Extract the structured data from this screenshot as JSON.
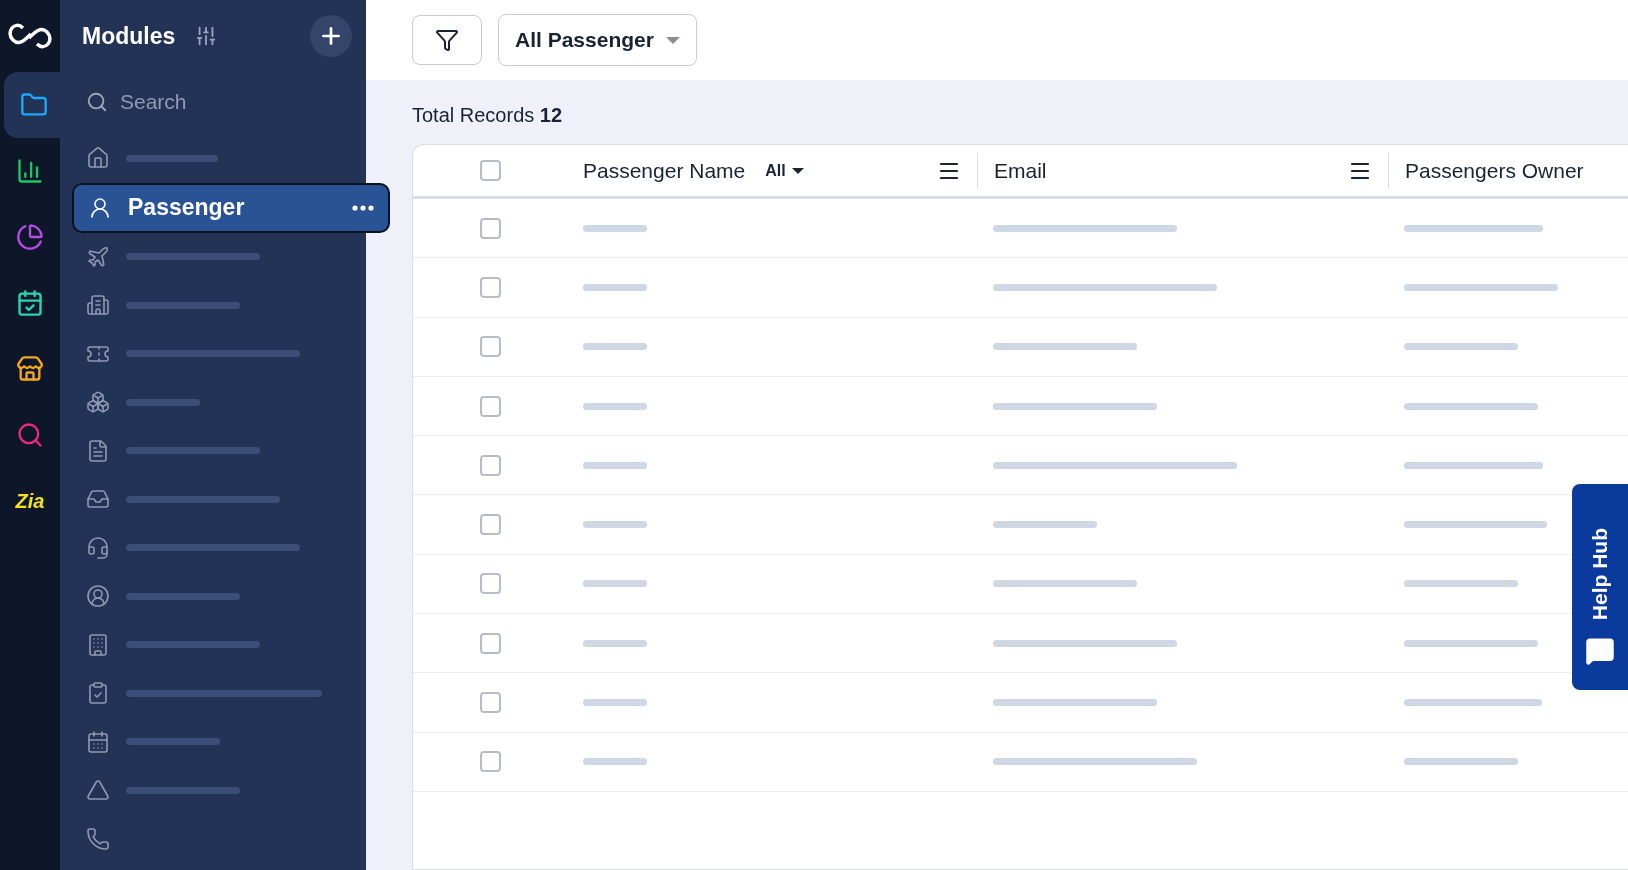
{
  "rail": {
    "items": [
      {
        "kind": "folder",
        "selected": true,
        "color": "#1ea7fd"
      },
      {
        "kind": "chart",
        "selected": false,
        "color": "#22c55e"
      },
      {
        "kind": "pie",
        "selected": false,
        "color": "#b44ce6"
      },
      {
        "kind": "calendar",
        "selected": false,
        "color": "#2ad4b4"
      },
      {
        "kind": "store",
        "selected": false,
        "color": "#f5a623"
      },
      {
        "kind": "search",
        "selected": false,
        "color": "#ec2a7a"
      },
      {
        "kind": "text",
        "label": "Zia",
        "selected": false,
        "color": "#f2e21c"
      }
    ]
  },
  "modules": {
    "title": "Modules",
    "search": {
      "placeholder": "Search"
    },
    "items": [
      {
        "selected": false
      },
      {
        "label": "Passenger",
        "selected": true
      },
      {
        "selected": false
      },
      {
        "selected": false
      },
      {
        "selected": false
      },
      {
        "selected": false
      },
      {
        "selected": false
      },
      {
        "selected": false
      },
      {
        "selected": false
      },
      {
        "selected": false
      },
      {
        "selected": false
      },
      {
        "selected": false
      },
      {
        "selected": false
      },
      {
        "selected": false
      },
      {
        "selected": false
      }
    ]
  },
  "toolbar": {
    "view": "All Passenger"
  },
  "total": {
    "label": "Total Records",
    "count": "12"
  },
  "table": {
    "select_all": {
      "checked": false
    },
    "columns": [
      {
        "label": "Passenger Name",
        "filter": "All"
      },
      {
        "label": "Email"
      },
      {
        "label": "Passengers Owner"
      }
    ],
    "rows": [
      {
        "checked": false
      },
      {
        "checked": false
      },
      {
        "checked": false
      },
      {
        "checked": false
      },
      {
        "checked": false
      },
      {
        "checked": false
      },
      {
        "checked": false
      },
      {
        "checked": false
      },
      {
        "checked": false
      },
      {
        "checked": false
      }
    ]
  },
  "help": {
    "label": "Help Hub"
  }
}
